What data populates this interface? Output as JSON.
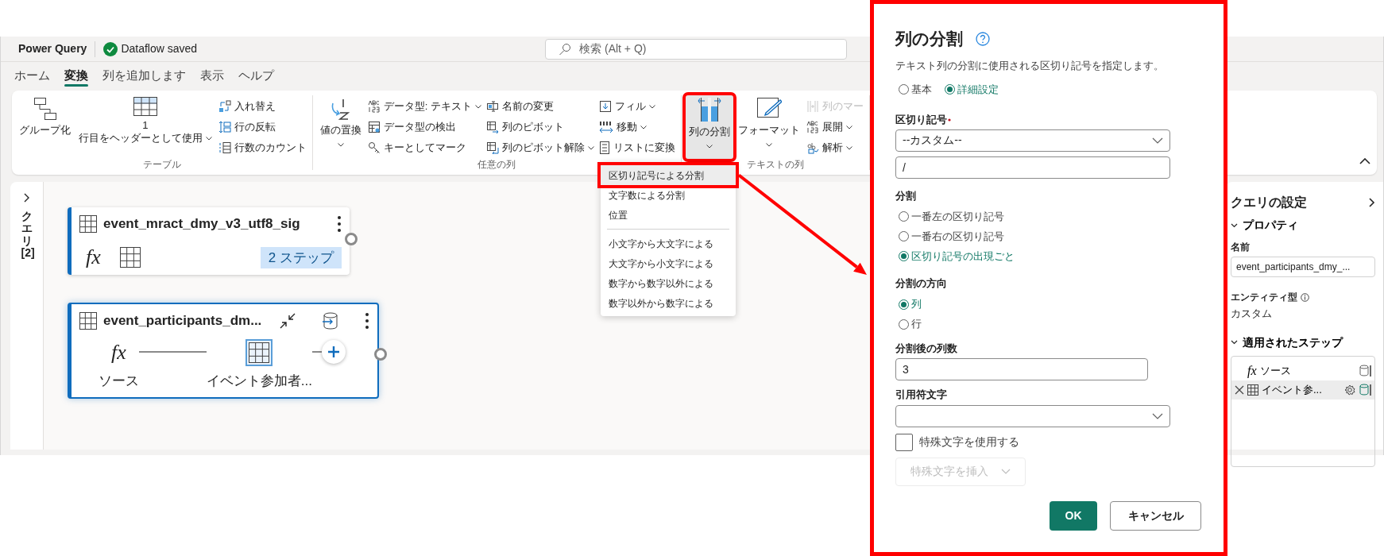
{
  "app": {
    "title": "Power Query",
    "save_status": "Dataflow saved",
    "search": {
      "placeholder": "検索 (Alt + Q)"
    }
  },
  "tabs": [
    {
      "label": "ホーム",
      "selected": false
    },
    {
      "label": "変換",
      "selected": true
    },
    {
      "label": "列を追加します",
      "selected": false
    },
    {
      "label": "表示",
      "selected": false
    },
    {
      "label": "ヘルプ",
      "selected": false
    }
  ],
  "ribbon": {
    "groups": [
      {
        "label": "テーブル",
        "columns": [
          {
            "kind": "large",
            "items": [
              {
                "label": "グループ化",
                "dropdown": false,
                "disabled": false,
                "expanded": false,
                "highlighted": false
              }
            ]
          },
          {
            "kind": "large",
            "items": [
              {
                "label": "1\n行目をヘッダーとして使用",
                "dropdown": true,
                "disabled": false,
                "expanded": false,
                "highlighted": false
              }
            ]
          },
          {
            "kind": "stack",
            "items": [
              {
                "label": "入れ替え",
                "dropdown": false,
                "disabled": false,
                "expanded": false,
                "highlighted": false
              },
              {
                "label": "行の反転",
                "dropdown": false,
                "disabled": false,
                "expanded": false,
                "highlighted": false
              },
              {
                "label": "行数のカウント",
                "dropdown": false,
                "disabled": false,
                "expanded": false,
                "highlighted": false
              }
            ]
          }
        ]
      },
      {
        "label": "任意の列",
        "columns": [
          {
            "kind": "large",
            "items": [
              {
                "label": "値の置換",
                "dropdown": true,
                "disabled": false,
                "expanded": false,
                "highlighted": false
              }
            ]
          },
          {
            "kind": "stack",
            "items": [
              {
                "label": "データ型: テキスト",
                "dropdown": true,
                "disabled": false,
                "expanded": false,
                "highlighted": false
              },
              {
                "label": "データ型の検出",
                "dropdown": false,
                "disabled": false,
                "expanded": false,
                "highlighted": false
              },
              {
                "label": "キーとしてマーク",
                "dropdown": false,
                "disabled": false,
                "expanded": false,
                "highlighted": false
              }
            ]
          },
          {
            "kind": "stack",
            "items": [
              {
                "label": "名前の変更",
                "dropdown": false,
                "disabled": false,
                "expanded": false,
                "highlighted": false
              },
              {
                "label": "列のピボット",
                "dropdown": false,
                "disabled": false,
                "expanded": false,
                "highlighted": false
              },
              {
                "label": "列のピボット解除",
                "dropdown": true,
                "disabled": false,
                "expanded": false,
                "highlighted": false
              }
            ]
          },
          {
            "kind": "stack",
            "items": [
              {
                "label": "フィル",
                "dropdown": true,
                "disabled": false,
                "expanded": false,
                "highlighted": false
              },
              {
                "label": "移動",
                "dropdown": true,
                "disabled": false,
                "expanded": false,
                "highlighted": false
              },
              {
                "label": "リストに変換",
                "dropdown": false,
                "disabled": false,
                "expanded": false,
                "highlighted": false
              }
            ]
          }
        ]
      },
      {
        "label": "テキストの列",
        "columns": [
          {
            "kind": "large",
            "items": [
              {
                "label": "列の分割",
                "dropdown": true,
                "disabled": false,
                "expanded": true,
                "highlighted": true
              }
            ]
          },
          {
            "kind": "large",
            "items": [
              {
                "label": "フォーマット",
                "dropdown": true,
                "disabled": false,
                "expanded": false,
                "highlighted": false
              }
            ]
          },
          {
            "kind": "stack",
            "items": [
              {
                "label": "列のマー",
                "dropdown": false,
                "disabled": true,
                "expanded": false,
                "highlighted": false
              },
              {
                "label": "展開",
                "dropdown": true,
                "disabled": false,
                "expanded": false,
                "highlighted": false
              },
              {
                "label": "解析",
                "dropdown": true,
                "disabled": false,
                "expanded": false,
                "highlighted": false
              }
            ]
          }
        ]
      }
    ]
  },
  "split_menu": {
    "items": [
      {
        "kind": "item",
        "label": "区切り記号による分割",
        "highlighted": true
      },
      {
        "kind": "item",
        "label": "文字数による分割",
        "highlighted": false
      },
      {
        "kind": "item",
        "label": "位置",
        "highlighted": false
      },
      {
        "kind": "separator"
      },
      {
        "kind": "item",
        "label": "小文字から大文字による",
        "highlighted": false
      },
      {
        "kind": "item",
        "label": "大文字から小文字による",
        "highlighted": false
      },
      {
        "kind": "item",
        "label": "数字から数字以外による",
        "highlighted": false
      },
      {
        "kind": "item",
        "label": "数字以外から数字による",
        "highlighted": false
      }
    ]
  },
  "queries_panel": {
    "label": "クエリ [2]"
  },
  "canvas": {
    "queries": [
      {
        "name": "event_mract_dmy_v3_utf8_sig",
        "selected": false,
        "expanded": false,
        "step_count": "2 ステップ",
        "steps": [
          {
            "kind": "source",
            "glyph": "fx"
          },
          {
            "kind": "table"
          }
        ]
      },
      {
        "name": "event_participants_dm...",
        "selected": true,
        "expanded": true,
        "steps": [
          {
            "kind": "source",
            "glyph": "fx",
            "label": "ソース",
            "selected": false
          },
          {
            "kind": "table",
            "label": "イベント参加者...",
            "selected": true
          }
        ]
      }
    ]
  },
  "settings": {
    "title": "クエリの設定",
    "properties": {
      "title": "プロパティ",
      "expanded": true,
      "name_label": "名前",
      "name_value": "event_participants_dmy_...",
      "entity_label": "エンティティ型",
      "entity_value": "カスタム"
    },
    "applied_steps": {
      "title": "適用されたステップ",
      "expanded": true,
      "steps": [
        {
          "kind": "source",
          "glyph": "fx",
          "label": "ソース",
          "selected": false
        },
        {
          "kind": "table",
          "label": "イベント参...",
          "selected": true
        }
      ]
    }
  },
  "dialog": {
    "title": "列の分割",
    "highlighted": true,
    "description": "テキスト列の分割に使用される区切り記号を指定します。",
    "modes": [
      {
        "label": "基本",
        "selected": false
      },
      {
        "label": "詳細設定",
        "selected": true
      }
    ],
    "delimiter": {
      "label": "区切り記号",
      "required": true,
      "value": "--カスタム--",
      "custom_value": "/"
    },
    "split_at": {
      "label": "分割",
      "options": [
        {
          "label": "一番左の区切り記号",
          "selected": false
        },
        {
          "label": "一番右の区切り記号",
          "selected": false
        },
        {
          "label": "区切り記号の出現ごと",
          "selected": true
        }
      ]
    },
    "direction": {
      "label": "分割の方向",
      "options": [
        {
          "label": "列",
          "selected": true
        },
        {
          "label": "行",
          "selected": false
        }
      ]
    },
    "column_count": {
      "label": "分割後の列数",
      "value": "3"
    },
    "quote_char": {
      "label": "引用符文字"
    },
    "special_chars": {
      "label": "特殊文字を使用する",
      "checked": false
    },
    "insert_special": {
      "label": "特殊文字を挿入",
      "disabled": true
    },
    "buttons": [
      {
        "label": "OK",
        "kind": "primary"
      },
      {
        "label": "キャンセル",
        "kind": "secondary"
      }
    ]
  }
}
